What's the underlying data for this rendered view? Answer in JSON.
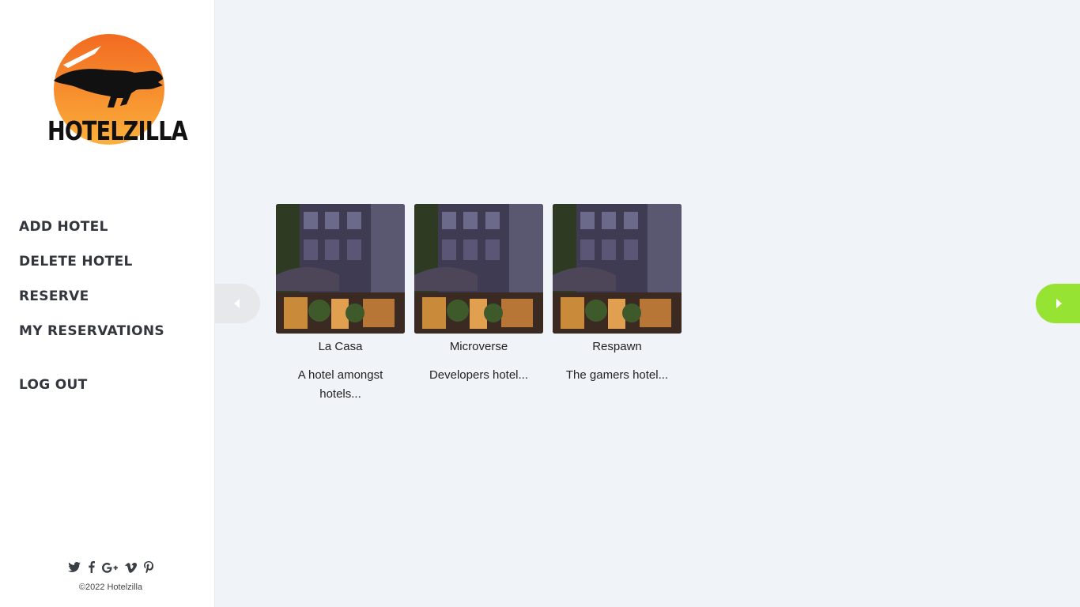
{
  "brand": {
    "name": "HOTELZILLA",
    "sun_color_top": "#f26a21",
    "sun_color_bottom": "#fbb03b"
  },
  "nav": {
    "items": [
      {
        "label": "ADD HOTEL"
      },
      {
        "label": "DELETE HOTEL"
      },
      {
        "label": "RESERVE"
      },
      {
        "label": "MY RESERVATIONS"
      }
    ],
    "logout": "LOG OUT"
  },
  "social": {
    "icons": [
      {
        "name": "twitter-icon",
        "glyph": "🐦"
      },
      {
        "name": "facebook-icon",
        "glyph": "f"
      },
      {
        "name": "google-plus-icon",
        "glyph": "G+"
      },
      {
        "name": "vimeo-icon",
        "glyph": "v"
      },
      {
        "name": "pinterest-icon",
        "glyph": "℘"
      }
    ]
  },
  "footer": {
    "copyright": "©2022 Hotelzilla"
  },
  "carousel": {
    "prev_color": "#e6e8ec",
    "next_color": "#97e333",
    "hotels": [
      {
        "name": "La Casa",
        "description": "A hotel amongst hotels..."
      },
      {
        "name": "Microverse",
        "description": "Developers hotel..."
      },
      {
        "name": "Respawn",
        "description": "The gamers hotel..."
      }
    ]
  }
}
